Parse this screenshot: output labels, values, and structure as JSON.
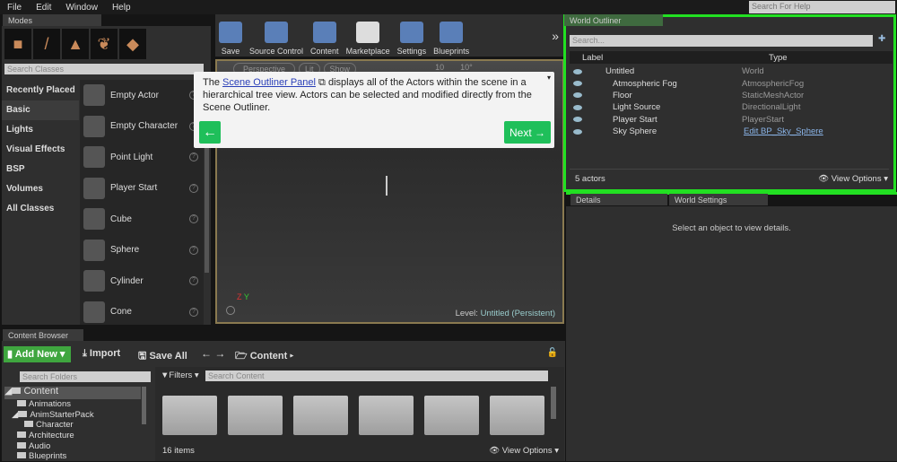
{
  "menu": [
    "File",
    "Edit",
    "Window",
    "Help"
  ],
  "help_search_placeholder": "Search For Help",
  "modes": {
    "tab": "Modes",
    "search_placeholder": "Search Classes",
    "categories": [
      "Recently Placed",
      "Basic",
      "Lights",
      "Visual Effects",
      "BSP",
      "Volumes",
      "All Classes"
    ],
    "selected_category": "Basic",
    "items": [
      "Empty Actor",
      "Empty Character",
      "Point Light",
      "Player Start",
      "Cube",
      "Sphere",
      "Cylinder",
      "Cone"
    ]
  },
  "toolbar": [
    "Save",
    "Source Control",
    "Content",
    "Marketplace",
    "Settings",
    "Blueprints"
  ],
  "viewport": {
    "buttons": [
      "Perspective",
      "Lit",
      "Show",
      "10",
      "10°"
    ],
    "level_label": "Level:",
    "level_value": "Untitled (Persistent)"
  },
  "tooltip": {
    "link": "Scene Outliner Panel",
    "text": " displays all of the Actors within the scene in a hierarchical tree view. Actors can be selected and modified directly from the Scene Outliner.",
    "next": "Next"
  },
  "outliner": {
    "tab": "World Outliner",
    "search_placeholder": "Search...",
    "col_label": "Label",
    "col_type": "Type",
    "rows": [
      {
        "label": "Untitled",
        "type": "World"
      },
      {
        "label": "Atmospheric Fog",
        "type": "AtmosphericFog"
      },
      {
        "label": "Floor",
        "type": "StaticMeshActor"
      },
      {
        "label": "Light Source",
        "type": "DirectionalLight"
      },
      {
        "label": "Player Start",
        "type": "PlayerStart"
      },
      {
        "label": "Sky Sphere",
        "type": "Edit BP_Sky_Sphere"
      }
    ],
    "count": "5 actors",
    "view_options": "View Options"
  },
  "details": {
    "tab1": "Details",
    "tab2": "World Settings",
    "empty": "Select an object to view details."
  },
  "content_browser": {
    "tab": "Content Browser",
    "add_new": "Add New",
    "import": "Import",
    "save_all": "Save All",
    "path": "Content",
    "folder_search": "Search Folders",
    "filters": "Filters",
    "content_search": "Search Content",
    "tree": [
      "Content",
      "Animations",
      "AnimStarterPack",
      "Character",
      "Architecture",
      "Audio",
      "Blueprints"
    ],
    "items": "16 items",
    "view_options": "View Options"
  }
}
